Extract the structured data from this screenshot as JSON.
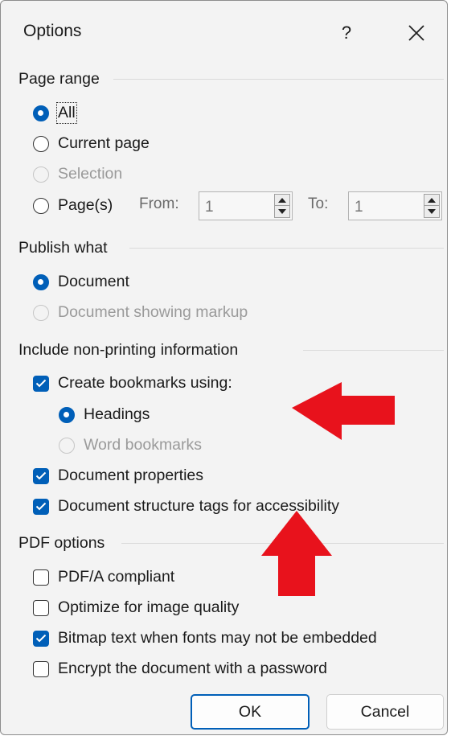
{
  "window": {
    "title": "Options",
    "help_label": "?"
  },
  "page_range": {
    "heading": "Page range",
    "all": "All",
    "current_page": "Current page",
    "selection": "Selection",
    "pages": "Page(s)",
    "from_label": "From:",
    "from_value": "1",
    "to_label": "To:",
    "to_value": "1"
  },
  "publish_what": {
    "heading": "Publish what",
    "document": "Document",
    "document_markup": "Document showing markup"
  },
  "non_printing": {
    "heading": "Include non-printing information",
    "create_bookmarks": "Create bookmarks using:",
    "headings": "Headings",
    "word_bookmarks": "Word bookmarks",
    "document_properties": "Document properties",
    "structure_tags": "Document structure tags for accessibility"
  },
  "pdf_options": {
    "heading": "PDF options",
    "pdfa": "PDF/A compliant",
    "optimize": "Optimize for image quality",
    "bitmap_text": "Bitmap text when fonts may not be embedded",
    "encrypt": "Encrypt the document with a password"
  },
  "buttons": {
    "ok": "OK",
    "cancel": "Cancel"
  },
  "state": {
    "page_range": "All",
    "publish_what": "Document",
    "bookmarks_source": "Headings",
    "create_bookmarks": true,
    "document_properties": true,
    "structure_tags": true,
    "pdfa": false,
    "optimize": false,
    "bitmap_text": true,
    "encrypt": false
  },
  "colors": {
    "accent": "#005fb8",
    "annotation": "#e8121c",
    "dialog_bg": "#f3f3f3"
  }
}
